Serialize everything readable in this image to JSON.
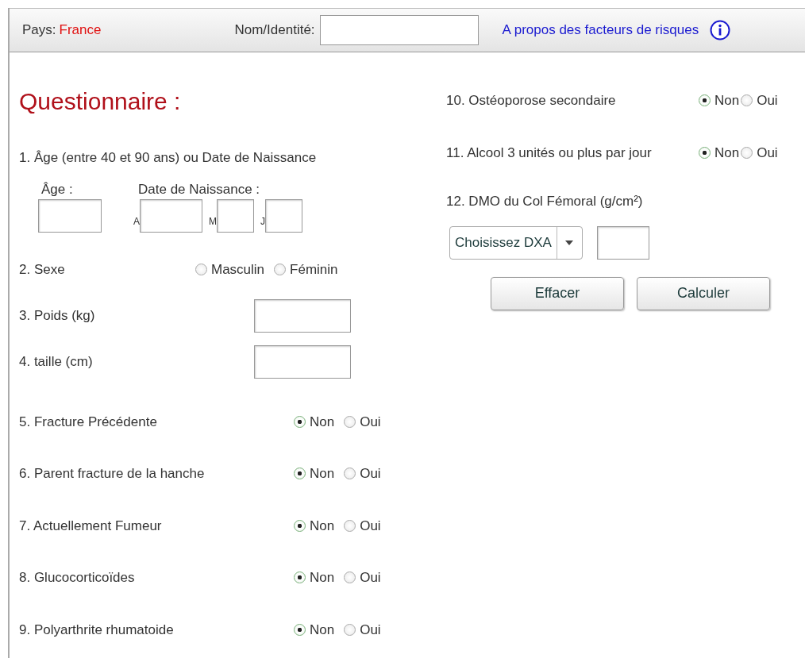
{
  "header": {
    "country_label": "Pays:",
    "country": "France",
    "name_label": "Nom/Identité:",
    "about_link": "A propos des facteurs de risques"
  },
  "title": "Questionnaire :",
  "left_questions": [
    {
      "kind": "age",
      "label": "1. Âge (entre 40 et 90 ans) ou Date de Naissance",
      "age_label": "Âge :",
      "dob_label": "Date de Naissance :",
      "parts": [
        "A",
        "M",
        "J"
      ]
    },
    {
      "kind": "choice",
      "label": "2. Sexe",
      "options": [
        {
          "label": "Masculin",
          "selected": false
        },
        {
          "label": "Féminin",
          "selected": false
        }
      ]
    },
    {
      "kind": "field",
      "label": "3. Poids (kg)"
    },
    {
      "kind": "field",
      "label": "4. taille (cm)"
    },
    {
      "kind": "yesno",
      "label": "5. Fracture Précédente",
      "options": [
        {
          "label": "Non",
          "selected": true
        },
        {
          "label": "Oui",
          "selected": false
        }
      ]
    },
    {
      "kind": "yesno",
      "label": "6. Parent fracture de la hanche",
      "options": [
        {
          "label": "Non",
          "selected": true
        },
        {
          "label": "Oui",
          "selected": false
        }
      ]
    },
    {
      "kind": "yesno",
      "label": "7. Actuellement Fumeur",
      "options": [
        {
          "label": "Non",
          "selected": true
        },
        {
          "label": "Oui",
          "selected": false
        }
      ]
    },
    {
      "kind": "yesno",
      "label": "8. Glucocorticoïdes",
      "options": [
        {
          "label": "Non",
          "selected": true
        },
        {
          "label": "Oui",
          "selected": false
        }
      ]
    },
    {
      "kind": "yesno",
      "label": "9. Polyarthrite rhumatoide",
      "options": [
        {
          "label": "Non",
          "selected": true
        },
        {
          "label": "Oui",
          "selected": false
        }
      ]
    }
  ],
  "right_questions": [
    {
      "kind": "yesno",
      "label": "10. Ostéoporose secondaire",
      "options": [
        {
          "label": "Non",
          "selected": true
        },
        {
          "label": "Oui",
          "selected": false
        }
      ]
    },
    {
      "kind": "yesno",
      "label": "11. Alcool 3 unités ou plus par jour",
      "options": [
        {
          "label": "Non",
          "selected": true
        },
        {
          "label": "Oui",
          "selected": false
        }
      ]
    },
    {
      "kind": "bmd",
      "label": "12. DMO du Col Fémoral (g/cm²)",
      "select": "Choisissez DXA"
    }
  ],
  "buttons": [
    "Effacer",
    "Calculer"
  ]
}
